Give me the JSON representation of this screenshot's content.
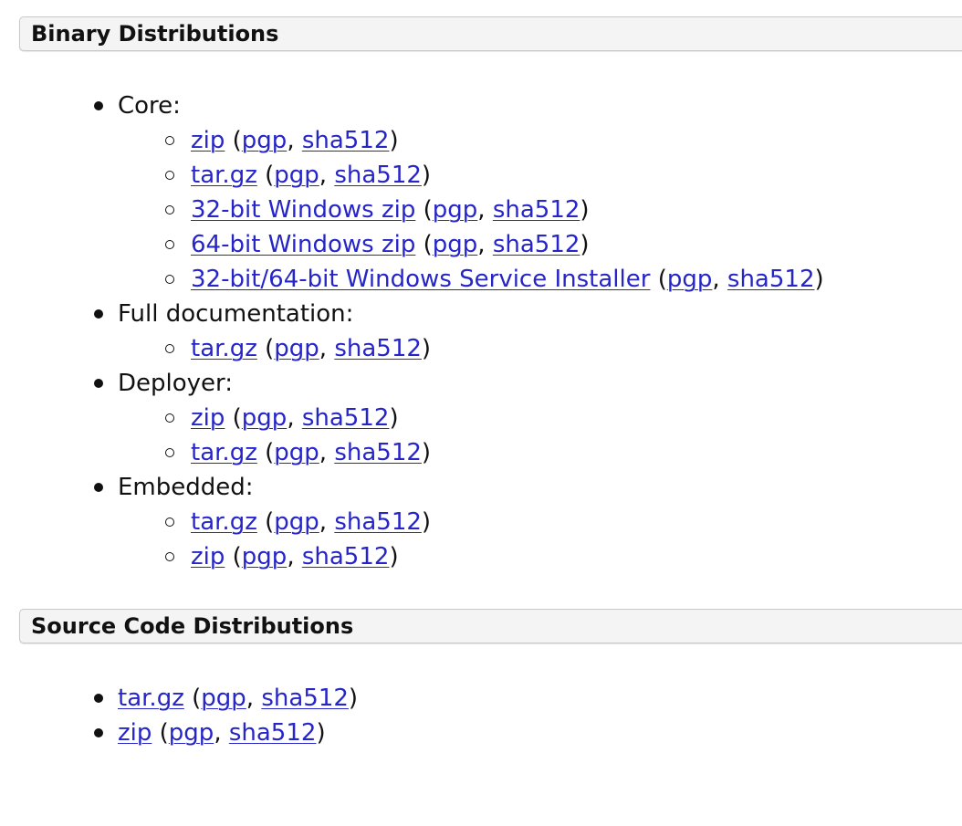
{
  "sections": {
    "binary": {
      "title": "Binary Distributions",
      "groups": [
        {
          "label": "Core:",
          "items": [
            {
              "file": "zip",
              "sig": "pgp",
              "hash": "sha512"
            },
            {
              "file": "tar.gz",
              "sig": "pgp",
              "hash": "sha512"
            },
            {
              "file": "32-bit Windows zip",
              "sig": "pgp",
              "hash": "sha512"
            },
            {
              "file": "64-bit Windows zip",
              "sig": "pgp",
              "hash": "sha512"
            },
            {
              "file": "32-bit/64-bit Windows Service Installer",
              "sig": "pgp",
              "hash": "sha512"
            }
          ]
        },
        {
          "label": "Full documentation:",
          "items": [
            {
              "file": "tar.gz",
              "sig": "pgp",
              "hash": "sha512"
            }
          ]
        },
        {
          "label": "Deployer:",
          "items": [
            {
              "file": "zip",
              "sig": "pgp",
              "hash": "sha512"
            },
            {
              "file": "tar.gz",
              "sig": "pgp",
              "hash": "sha512"
            }
          ]
        },
        {
          "label": "Embedded:",
          "items": [
            {
              "file": "tar.gz",
              "sig": "pgp",
              "hash": "sha512"
            },
            {
              "file": "zip",
              "sig": "pgp",
              "hash": "sha512"
            }
          ]
        }
      ]
    },
    "source": {
      "title": "Source Code Distributions",
      "items": [
        {
          "file": "tar.gz",
          "sig": "pgp",
          "hash": "sha512"
        },
        {
          "file": "zip",
          "sig": "pgp",
          "hash": "sha512"
        }
      ]
    }
  },
  "punctuation": {
    "open": " (",
    "sep": ", ",
    "close": ")"
  },
  "colors": {
    "link": "#2626c8",
    "header_bg": "#f4f4f4",
    "header_border": "#c8c8c8"
  }
}
